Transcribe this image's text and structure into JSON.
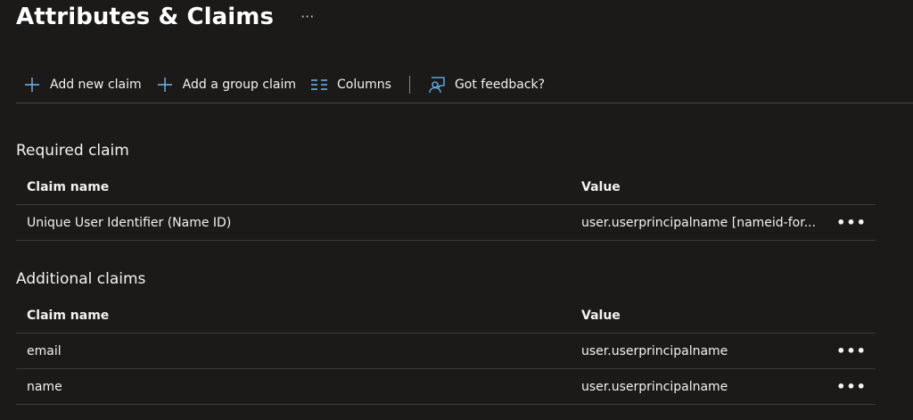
{
  "page": {
    "title": "Attributes & Claims",
    "title_more": "···"
  },
  "toolbar": {
    "add_new_claim": "Add new claim",
    "add_group_claim": "Add a group claim",
    "columns": "Columns",
    "feedback": "Got feedback?"
  },
  "required": {
    "section_title": "Required claim",
    "headers": {
      "name": "Claim name",
      "value": "Value"
    },
    "rows": [
      {
        "name": "Unique User Identifier (Name ID)",
        "value": "user.userprincipalname [nameid-for...",
        "more": "•••"
      }
    ]
  },
  "additional": {
    "section_title": "Additional claims",
    "headers": {
      "name": "Claim name",
      "value": "Value"
    },
    "rows": [
      {
        "name": "email",
        "value": "user.userprincipalname",
        "more": "•••"
      },
      {
        "name": "name",
        "value": "user.userprincipalname",
        "more": "•••"
      }
    ]
  },
  "colors": {
    "background": "#1b1a19",
    "accent_icon": "#6cb8f6",
    "text": "#f3f2f1",
    "divider": "#3b3a39"
  }
}
